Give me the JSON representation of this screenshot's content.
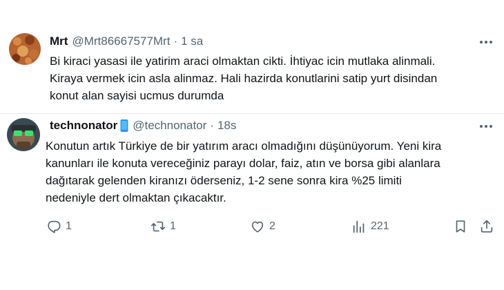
{
  "tweets": [
    {
      "name": "Mrt",
      "handle": "@Mrt86667577Mrt",
      "separator": "·",
      "time": "1 sa",
      "text_lines": [
        "Bi kiraci yasasi ile yatirim araci olmaktan cikti. İhtiyac icin mutlaka alinmali.",
        "Kiraya vermek icin asla alinmaz. Hali hazirda konutlarini satip yurt disindan",
        "konut alan sayisi ucmus durumda"
      ]
    },
    {
      "name": "technonator",
      "handle": "@technonator",
      "separator": "·",
      "time": "18s",
      "text_lines": [
        "Konutun artık Türkiye de bir yatırım aracı olmadığını düşünüyorum. Yeni kira",
        "kanunları ile konuta vereceğiniz parayı dolar, faiz, atın ve borsa gibi alanlara",
        "dağıtarak gelenden kiranızı öderseniz, 1-2 sene sonra kira %25 limiti",
        "nedeniyle dert olmaktan çıkacaktır."
      ],
      "actions": {
        "replies": "1",
        "retweets": "1",
        "likes": "2",
        "views": "221"
      }
    }
  ],
  "colors": {
    "text": "#0f1419",
    "secondary": "#536471",
    "divider": "#e6ebee",
    "badge": "#1d9bf0"
  },
  "icons": [
    "more-icon",
    "reply-icon",
    "retweet-icon",
    "like-icon",
    "views-icon",
    "bookmark-icon",
    "share-icon",
    "phone-badge-icon"
  ]
}
